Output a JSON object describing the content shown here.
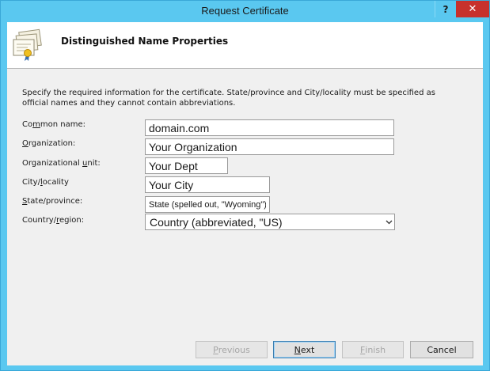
{
  "window": {
    "title": "Request Certificate",
    "help_label": "?",
    "close_label": "✕"
  },
  "header": {
    "title": "Distinguished Name Properties",
    "icon": "certificate-icon"
  },
  "description": "Specify the required information for the certificate. State/province and City/locality must be specified as official names and they cannot contain abbreviations.",
  "form": {
    "common_name": {
      "label_pre": "Co",
      "label_key": "m",
      "label_post": "mon name:",
      "value": "domain.com"
    },
    "organization": {
      "label_pre": "",
      "label_key": "O",
      "label_post": "rganization:",
      "value": "Your Organization"
    },
    "org_unit": {
      "label_pre": "Organizational ",
      "label_key": "u",
      "label_post": "nit:",
      "value": "Your Dept"
    },
    "city": {
      "label_pre": "City/",
      "label_key": "l",
      "label_post": "ocality",
      "value": "Your City"
    },
    "state": {
      "label_pre": "",
      "label_key": "S",
      "label_post": "tate/province:",
      "value": "State (spelled out, \"Wyoming\")"
    },
    "country": {
      "label_pre": "Country/",
      "label_key": "r",
      "label_post": "egion:",
      "value": "Country (abbreviated, \"US)"
    }
  },
  "buttons": {
    "previous": {
      "pre": "",
      "key": "P",
      "post": "revious"
    },
    "next": {
      "pre": "",
      "key": "N",
      "post": "ext"
    },
    "finish": {
      "pre": "",
      "key": "F",
      "post": "inish"
    },
    "cancel": {
      "label": "Cancel"
    }
  },
  "colors": {
    "titlebar": "#5ac8f0",
    "close": "#c7312c",
    "client": "#f0f0f0"
  }
}
